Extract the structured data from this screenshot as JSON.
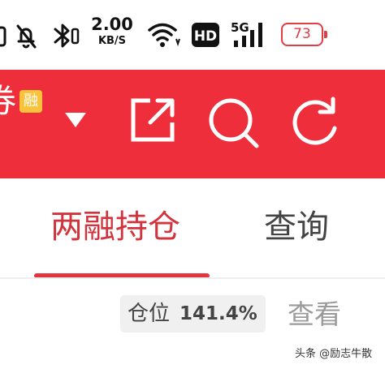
{
  "status_bar": {
    "icons": [
      "partial-icon",
      "bell-off-icon",
      "bluetooth-icon",
      "wifi-icon",
      "hd-icon",
      "signal-5g-icon",
      "battery-icon"
    ],
    "net_speed_value": "2.00",
    "net_speed_unit": "KB/S",
    "hd_label": "HD",
    "network_label": "5G",
    "battery_level": "73"
  },
  "header": {
    "title_fragment": "券",
    "margin_badge": "融",
    "icons": [
      "dropdown-arrow-icon",
      "external-link-icon",
      "search-icon",
      "refresh-icon"
    ],
    "background_color": "#ee2e3a"
  },
  "tabs": [
    {
      "label": "两融持仓",
      "active": true
    },
    {
      "label": "查询",
      "active": false
    }
  ],
  "position": {
    "label": "仓位",
    "value": "141.4%",
    "view_label": "查看"
  },
  "watermark": "头条 @励志牛散",
  "colors": {
    "accent": "#e33540",
    "badge": "#f8c33a",
    "battery": "#e23c44"
  }
}
